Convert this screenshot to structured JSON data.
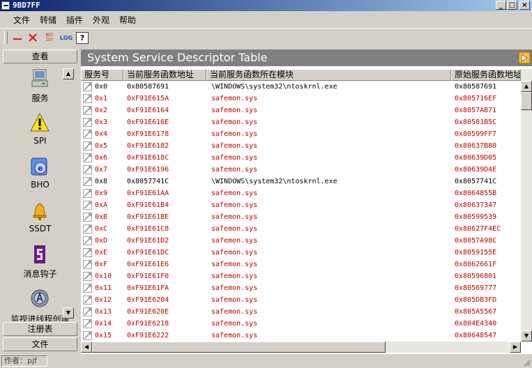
{
  "window": {
    "title": "9BD7FF"
  },
  "menu": [
    "文件",
    "转储",
    "插件",
    "外观",
    "帮助"
  ],
  "toolbar": {
    "bdt_label_top": "BDT",
    "bdt_label_bottom": "IDT",
    "log_label": "LOG",
    "help_label": "?"
  },
  "sidebar": {
    "header_top": "查看",
    "items": [
      {
        "label": "服务",
        "icon": "computer-icon"
      },
      {
        "label": "SPI",
        "icon": "warning-icon"
      },
      {
        "label": "BHO",
        "icon": "ie-icon"
      },
      {
        "label": "SSDT",
        "icon": "bell-icon"
      },
      {
        "label": "消息钩子",
        "icon": "hook-icon"
      },
      {
        "label": "监视进线程创建",
        "icon": "monitor-icon"
      }
    ],
    "footer_items": [
      "注册表",
      "文件"
    ]
  },
  "panel": {
    "title": "System Service Descriptor Table"
  },
  "table": {
    "headers": [
      "服务号",
      "当前服务函数地址",
      "当前服务函数所在模块",
      "原始服务函数地址"
    ],
    "rows": [
      {
        "idx": "0x0",
        "addr": "0x80587691",
        "module": "\\WINDOWS\\system32\\ntoskrnl.exe",
        "orig": "0x80587691",
        "hooked": false
      },
      {
        "idx": "0x1",
        "addr": "0xF91E615A",
        "module": "safemon.sys",
        "orig": "0x805716EF",
        "hooked": true
      },
      {
        "idx": "0x2",
        "addr": "0xF91E6164",
        "module": "safemon.sys",
        "orig": "0x8057AB71",
        "hooked": true
      },
      {
        "idx": "0x3",
        "addr": "0xF91E616E",
        "module": "safemon.sys",
        "orig": "0x80581B5C",
        "hooked": true
      },
      {
        "idx": "0x4",
        "addr": "0xF91E6178",
        "module": "safemon.sys",
        "orig": "0x80599FF7",
        "hooked": true
      },
      {
        "idx": "0x5",
        "addr": "0xF91E6182",
        "module": "safemon.sys",
        "orig": "0x80637B80",
        "hooked": true
      },
      {
        "idx": "0x6",
        "addr": "0xF91E618C",
        "module": "safemon.sys",
        "orig": "0x80639D05",
        "hooked": true
      },
      {
        "idx": "0x7",
        "addr": "0xF91E6196",
        "module": "safemon.sys",
        "orig": "0x80639D4E",
        "hooked": true
      },
      {
        "idx": "0x8",
        "addr": "0x8057741C",
        "module": "\\WINDOWS\\system32\\ntoskrnl.exe",
        "orig": "0x8057741C",
        "hooked": false
      },
      {
        "idx": "0x9",
        "addr": "0xF91E61AA",
        "module": "safemon.sys",
        "orig": "0x8064855B",
        "hooked": true
      },
      {
        "idx": "0xA",
        "addr": "0xF91E61B4",
        "module": "safemon.sys",
        "orig": "0x80637347",
        "hooked": true
      },
      {
        "idx": "0xB",
        "addr": "0xF91E61BE",
        "module": "safemon.sys",
        "orig": "0x80599539",
        "hooked": true
      },
      {
        "idx": "0xC",
        "addr": "0xF91E61C8",
        "module": "safemon.sys",
        "orig": "0x80627F4EC",
        "hooked": true
      },
      {
        "idx": "0xD",
        "addr": "0xF91E61D2",
        "module": "safemon.sys",
        "orig": "0x8057A98C",
        "hooked": true
      },
      {
        "idx": "0xE",
        "addr": "0xF91E61DC",
        "module": "safemon.sys",
        "orig": "0x8059155E",
        "hooked": true
      },
      {
        "idx": "0xF",
        "addr": "0xF91E61E6",
        "module": "safemon.sys",
        "orig": "0x8062661F",
        "hooked": true
      },
      {
        "idx": "0x10",
        "addr": "0xF91E61F0",
        "module": "safemon.sys",
        "orig": "0x80596801",
        "hooked": true
      },
      {
        "idx": "0x11",
        "addr": "0xF91E61FA",
        "module": "safemon.sys",
        "orig": "0x80569777",
        "hooked": true
      },
      {
        "idx": "0x12",
        "addr": "0xF91E6204",
        "module": "safemon.sys",
        "orig": "0x805DB3FD",
        "hooked": true
      },
      {
        "idx": "0x13",
        "addr": "0xF91E620E",
        "module": "safemon.sys",
        "orig": "0x805A5567",
        "hooked": true
      },
      {
        "idx": "0x14",
        "addr": "0xF91E6218",
        "module": "safemon.sys",
        "orig": "0x804E4340",
        "hooked": true
      },
      {
        "idx": "0x15",
        "addr": "0xF91E6222",
        "module": "safemon.sys",
        "orig": "0x80648547",
        "hooked": true
      }
    ]
  },
  "status": {
    "text": "作者：pjf"
  },
  "colors": {
    "hooked": "#c00000",
    "normal": "#000000",
    "title_bg": "#808080"
  }
}
